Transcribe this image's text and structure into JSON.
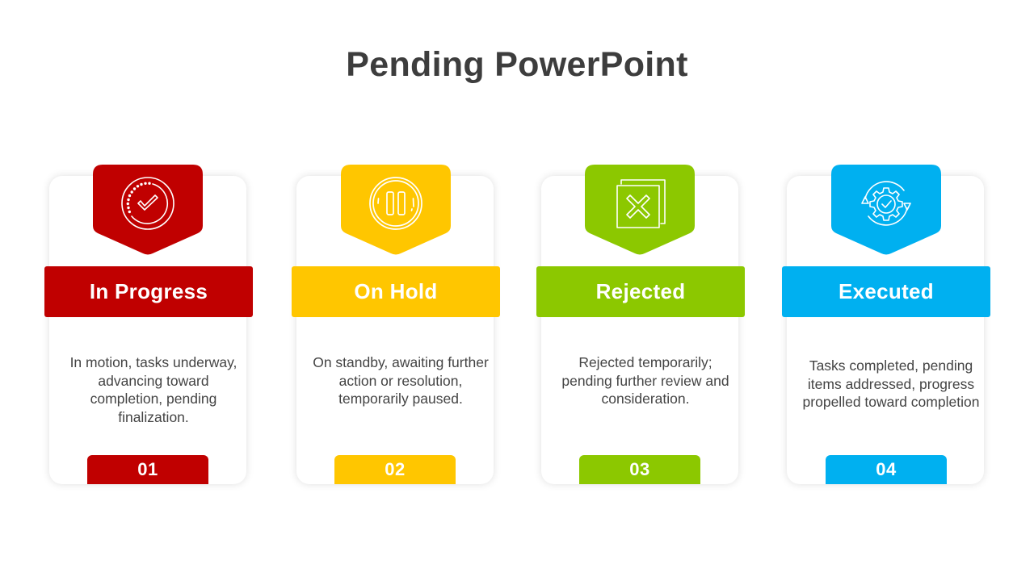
{
  "title": "Pending PowerPoint",
  "cards": [
    {
      "label": "In Progress",
      "description": "In motion, tasks underway, advancing toward completion, pending finalization.",
      "number": "01",
      "color": "#C00000",
      "icon": "check-circle-icon"
    },
    {
      "label": "On Hold",
      "description": "On standby, awaiting further action or resolution, temporarily paused.",
      "number": "02",
      "color": "#FFC600",
      "icon": "pause-circle-icon"
    },
    {
      "label": "Rejected",
      "description": "Rejected temporarily; pending further review and consideration.",
      "number": "03",
      "color": "#8CC800",
      "icon": "reject-documents-icon"
    },
    {
      "label": "Executed",
      "description": "Tasks completed, pending items addressed, progress propelled toward completion",
      "number": "04",
      "color": "#00B0F0",
      "icon": "gear-check-cycle-icon"
    }
  ]
}
